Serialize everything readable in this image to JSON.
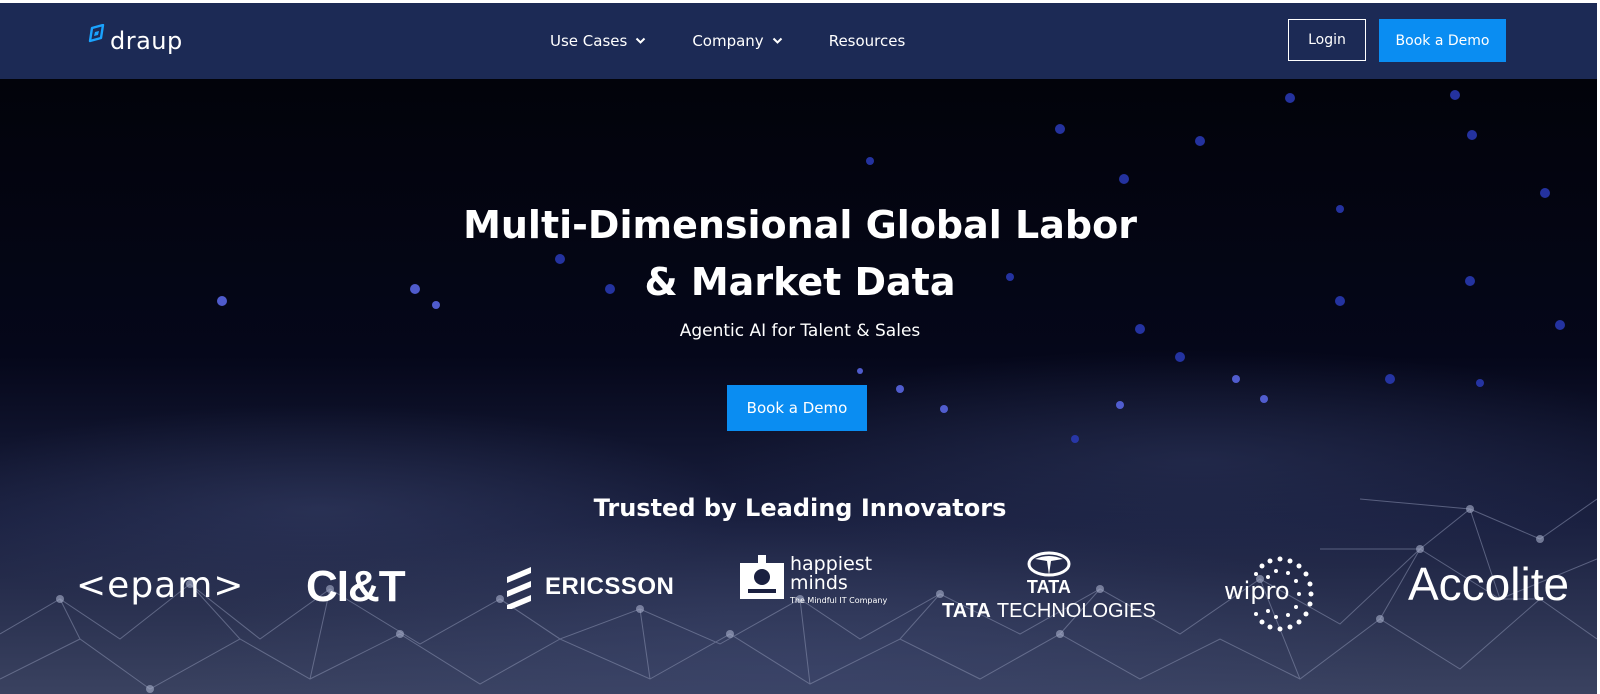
{
  "brand": {
    "name": "draup",
    "accent": "#0a8df2",
    "nav_bg": "#1c2a55"
  },
  "nav": {
    "menu": [
      {
        "label": "Use Cases",
        "dropdown": true
      },
      {
        "label": "Company",
        "dropdown": true
      },
      {
        "label": "Resources",
        "dropdown": false
      }
    ],
    "login_label": "Login",
    "demo_label": "Book a Demo"
  },
  "hero": {
    "title_line1": "Multi-Dimensional Global Labor",
    "title_line2": "& Market Data",
    "subtitle": "Agentic AI for Talent & Sales",
    "cta_label": "Book a Demo",
    "trusted_heading": "Trusted by Leading Innovators"
  },
  "logos": {
    "epam": "<epam>",
    "ciandt": "CI&T",
    "ericsson": "ERICSSON",
    "happiest_minds": {
      "line1": "happiest",
      "line2": "minds",
      "tagline": "The Mindful IT Company"
    },
    "tata": {
      "mark_word": "TATA",
      "tech_prefix": "TATA",
      "tech_suffix": "TECHNOLOGIES"
    },
    "wipro": "wipro",
    "accolite": "Accolite"
  },
  "icons": {
    "logo": "draup-logo-icon",
    "chevron": "chevron-down-icon"
  }
}
